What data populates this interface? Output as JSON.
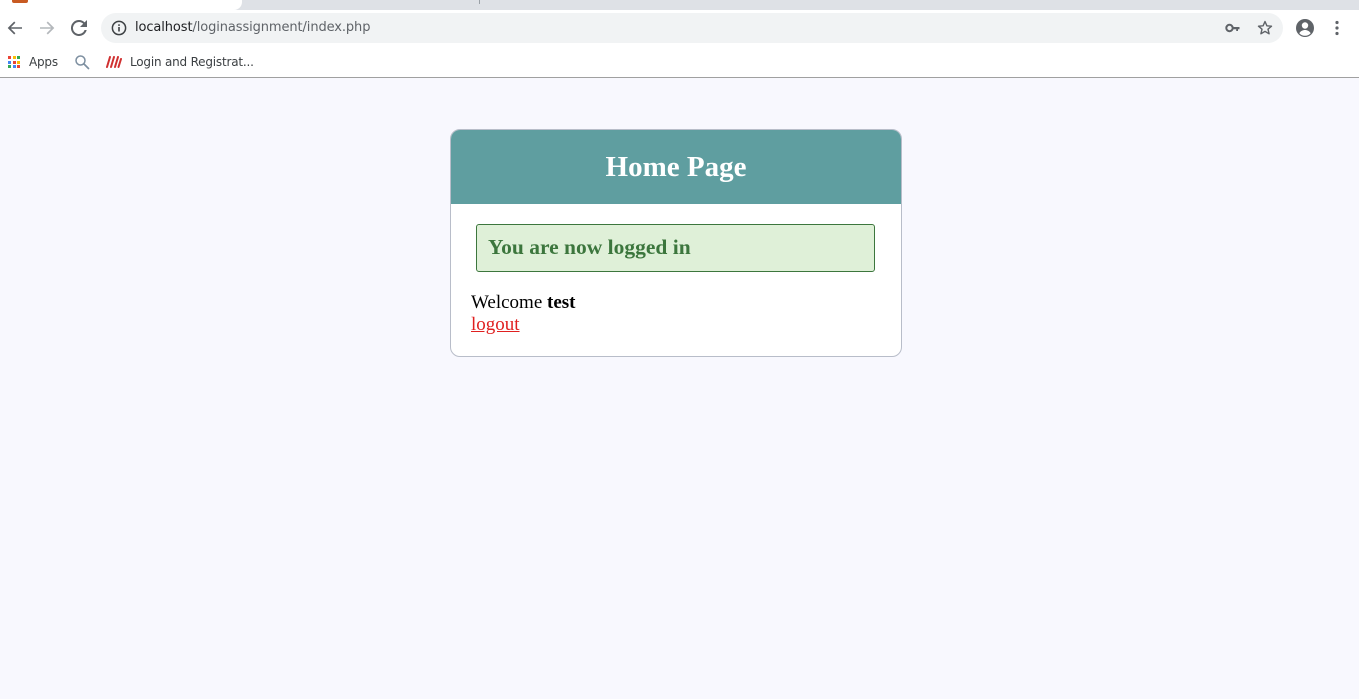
{
  "browser": {
    "url_host": "localhost",
    "url_path": "/loginassignment/index.php",
    "bookmarks": {
      "apps_label": "Apps",
      "login_bookmark_label": "Login and Registrat..."
    }
  },
  "page": {
    "header_title": "Home Page",
    "success_message": "You are now logged in",
    "welcome_prefix": "Welcome ",
    "username": "test",
    "logout_label": "logout"
  },
  "colors": {
    "header_bg": "#5f9ea0",
    "success_bg": "#dff0d8",
    "success_text": "#3c763d",
    "logout_link": "#e02020",
    "page_bg": "#f8f8fe"
  }
}
